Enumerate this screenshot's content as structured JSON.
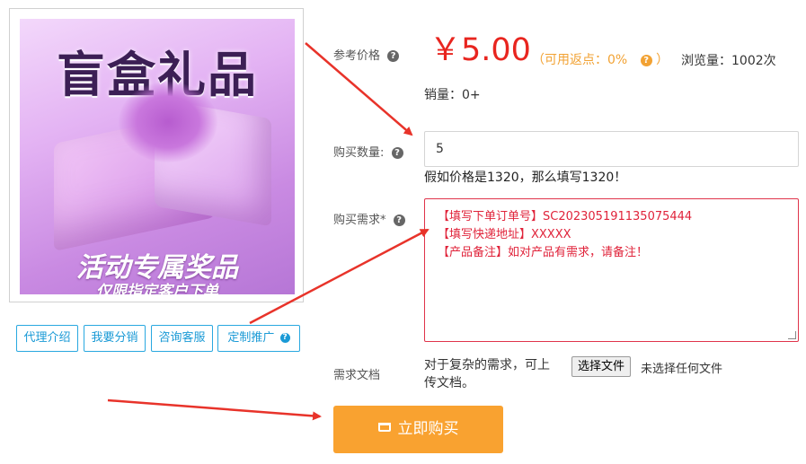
{
  "product_image": {
    "title": "盲盒礼品",
    "subtitle": "活动专属奖品",
    "caption": "仅限指定客户下单"
  },
  "side_buttons": [
    {
      "label": "代理介绍"
    },
    {
      "label": "我要分销"
    },
    {
      "label": "咨询客服"
    },
    {
      "label": "定制推广",
      "icon": "question-icon"
    }
  ],
  "price": {
    "label": "参考价格",
    "value": "￥5.00",
    "rebate": "（可用返点：0%",
    "rebate_close": "）",
    "views": "浏览量：1002次"
  },
  "sales": "销量：0+",
  "quantity": {
    "label": "购买数量:",
    "value": "5",
    "hint": "假如价格是1320，那么填写1320！"
  },
  "requirement": {
    "label": "购买需求*",
    "lines": [
      "【填写下单订单号】SC202305191135075444",
      "【填写快递地址】XXXXX",
      "【产品备注】如对产品有需求，请备注！"
    ]
  },
  "document": {
    "label": "需求文档",
    "description": "对于复杂的需求，可上传文档。",
    "choose_button": "选择文件",
    "no_file": "未选择任何文件"
  },
  "buy_button": "立即购买",
  "colors": {
    "price": "#e8251f",
    "rebate": "#f2a233",
    "buy_button": "#f9a230",
    "link_button": "#1a9ad6",
    "annotation_arrow": "#e8332a"
  }
}
